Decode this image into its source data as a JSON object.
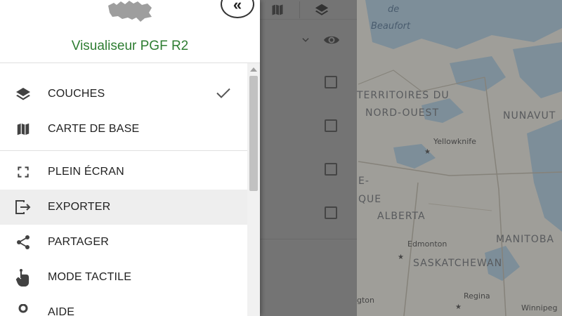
{
  "app": {
    "title": "Visualiseur PGF R2",
    "collapse_glyph": "«"
  },
  "menu": {
    "items": [
      {
        "label": "COUCHES",
        "icon": "layers-icon",
        "checked": true
      },
      {
        "label": "CARTE DE BASE",
        "icon": "map-icon"
      },
      {
        "label": "PLEIN ÉCRAN",
        "icon": "fullscreen-icon"
      },
      {
        "label": "EXPORTER",
        "icon": "export-icon",
        "active": true
      },
      {
        "label": "PARTAGER",
        "icon": "share-icon"
      },
      {
        "label": "MODE TACTILE",
        "icon": "touch-icon"
      },
      {
        "label": "AIDE",
        "icon": "help-icon"
      }
    ]
  },
  "map": {
    "labels": {
      "sea_1": "de",
      "sea_2": "Beaufort",
      "territories_1": "TERRITOIRES DU",
      "territories_2": "NORD-OUEST",
      "nunavut": "NUNAVUT",
      "yellowknife": "Yellowknife",
      "que_1": "E-",
      "que_2": "QUE",
      "alberta": "ALBERTA",
      "edmonton": "Edmonton",
      "manitoba": "MANITOBA",
      "saskatchewan": "SASKATCHEWAN",
      "regina": "Regina",
      "winnipeg": "Winnipeg",
      "gton": "gton"
    }
  },
  "colors": {
    "accent_title": "#2e7d32",
    "active_item_bg": "#eeeeee"
  }
}
